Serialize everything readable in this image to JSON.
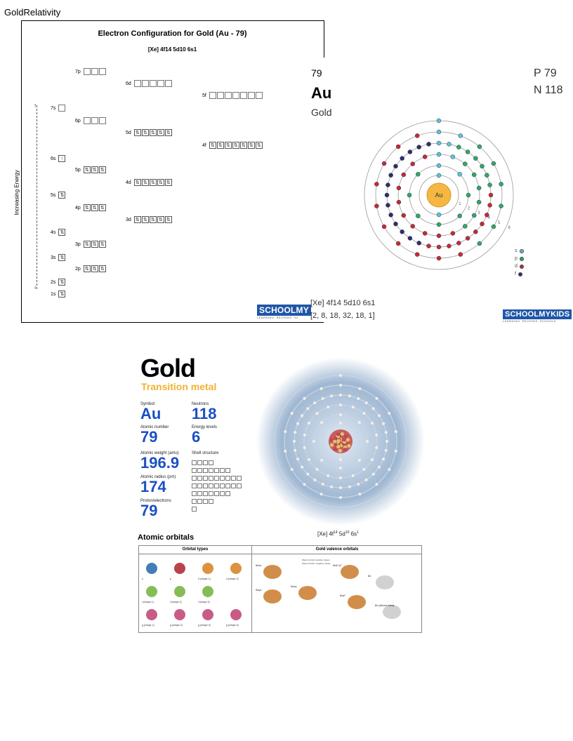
{
  "document": {
    "title": "GoldRelativity"
  },
  "config_diagram": {
    "heading": "Electron Configuration for Gold (Au - 79)",
    "subheading": "[Xe] 4f14 5d10 6s1",
    "axis_label": "Increasing Energy",
    "logo": "SCHOOLMY",
    "logo_tagline": "LEARNING. REVIEWS. SC",
    "orbitals": [
      {
        "label": "7p",
        "boxes": [
          "",
          "",
          ""
        ]
      },
      {
        "label": "6d",
        "boxes": [
          "",
          "",
          "",
          "",
          ""
        ]
      },
      {
        "label": "5f",
        "boxes": [
          "",
          "",
          "",
          "",
          "",
          "",
          ""
        ]
      },
      {
        "label": "7s",
        "boxes": [
          ""
        ]
      },
      {
        "label": "6p",
        "boxes": [
          "",
          "",
          ""
        ]
      },
      {
        "label": "5d",
        "boxes": [
          "⇅",
          "⇅",
          "⇅",
          "⇅",
          "⇅"
        ]
      },
      {
        "label": "4f",
        "boxes": [
          "⇅",
          "⇅",
          "⇅",
          "⇅",
          "⇅",
          "⇅",
          "⇅"
        ]
      },
      {
        "label": "6s",
        "boxes": [
          "↑"
        ]
      },
      {
        "label": "5p",
        "boxes": [
          "⇅",
          "⇅",
          "⇅"
        ]
      },
      {
        "label": "4d",
        "boxes": [
          "⇅",
          "⇅",
          "⇅",
          "⇅",
          "⇅"
        ]
      },
      {
        "label": "5s",
        "boxes": [
          "⇅"
        ]
      },
      {
        "label": "4p",
        "boxes": [
          "⇅",
          "⇅",
          "⇅"
        ]
      },
      {
        "label": "3d",
        "boxes": [
          "⇅",
          "⇅",
          "⇅",
          "⇅",
          "⇅"
        ]
      },
      {
        "label": "4s",
        "boxes": [
          "⇅"
        ]
      },
      {
        "label": "3p",
        "boxes": [
          "⇅",
          "⇅",
          "⇅"
        ]
      },
      {
        "label": "3s",
        "boxes": [
          "⇅"
        ]
      },
      {
        "label": "2p",
        "boxes": [
          "⇅",
          "⇅",
          "⇅"
        ]
      },
      {
        "label": "2s",
        "boxes": [
          "⇅"
        ]
      },
      {
        "label": "1s",
        "boxes": [
          "⇅"
        ]
      }
    ]
  },
  "bohr_model": {
    "atomic_number": "79",
    "symbol": "Au",
    "name": "Gold",
    "protons": "P 79",
    "neutrons": "N 118",
    "nucleus_label": "Au",
    "shell_numbers": [
      "1",
      "2",
      "3",
      "4",
      "5",
      "6"
    ],
    "legend": [
      "s",
      "p",
      "d",
      "f"
    ],
    "colors": {
      "s": "#5bc2e0",
      "p": "#2ea86a",
      "d": "#c7283a",
      "f": "#2b2f6e",
      "nucleus": "#f5b742"
    },
    "configuration": "[Xe] 4f14 5d10 6s1",
    "shells": "[2, 8, 18, 32, 18, 1]",
    "logo": "SCHOOLMYKIDS",
    "logo_tagline": "LEARNING. REVIEWS. SCHOOLS"
  },
  "gold_infographic": {
    "title": "Gold",
    "category": "Transition metal",
    "stats": [
      {
        "label": "Symbol",
        "value": "Au"
      },
      {
        "label": "Neutrons",
        "value": "118"
      },
      {
        "label": "Atomic number",
        "value": "79"
      },
      {
        "label": "Energy levels",
        "value": "6"
      },
      {
        "label": "Atomic weight (amu)",
        "value": "196.9"
      },
      {
        "label": "Shell structure",
        "value": ""
      },
      {
        "label": "Atomic radius (pm)",
        "value": "174"
      },
      {
        "label": "Proton/electrons",
        "value": "79"
      }
    ],
    "configuration": "[Xe] 4f",
    "config_sup1": "14",
    "config_mid": " 5d",
    "config_sup2": "10",
    "config_end": " 6s",
    "config_sup3": "1",
    "orbitals_heading": "Atomic orbitals",
    "orbital_types_heading": "Orbital types",
    "valence_heading": "Gold valence orbitals",
    "orbital_labels": [
      "s",
      "p",
      "d (shape 1)",
      "d (shape 2)",
      "f (shape 1)",
      "f (shape 2)",
      "f (shape 3)",
      "g (shape 1)",
      "g (shape 2)",
      "g (shape 3)",
      "g (shape 4)"
    ],
    "valence_labels": [
      "5dxz",
      "5dyz",
      "5dxy",
      "5dx²-y²",
      "5dz²",
      "6s",
      "6s (sliced view)"
    ],
    "legend_positive": "Wave function positive values",
    "legend_negative": "Wave function negative values"
  }
}
